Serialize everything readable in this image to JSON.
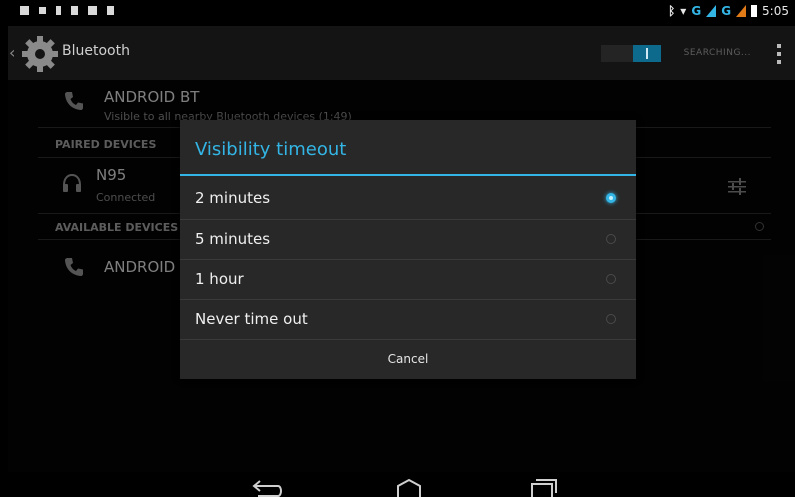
{
  "status_bar": {
    "time": "5:05",
    "network": "G"
  },
  "action_bar": {
    "title": "Bluetooth",
    "searching": "SEARCHING..."
  },
  "device": {
    "name": "ANDROID BT",
    "visibility": "Visible to all nearby Bluetooth devices (1:49)"
  },
  "paired": {
    "header": "PAIRED DEVICES",
    "items": [
      {
        "name": "N95",
        "status": "Connected"
      }
    ]
  },
  "available": {
    "header": "AVAILABLE DEVICES",
    "items": [
      {
        "name": "ANDROID"
      }
    ]
  },
  "dialog": {
    "title": "Visibility timeout",
    "options": [
      {
        "label": "2 minutes",
        "selected": true
      },
      {
        "label": "5 minutes",
        "selected": false
      },
      {
        "label": "1 hour",
        "selected": false
      },
      {
        "label": "Never time out",
        "selected": false
      }
    ],
    "cancel": "Cancel"
  },
  "colors": {
    "accent": "#33b5e5",
    "dialog_bg": "#282828"
  }
}
